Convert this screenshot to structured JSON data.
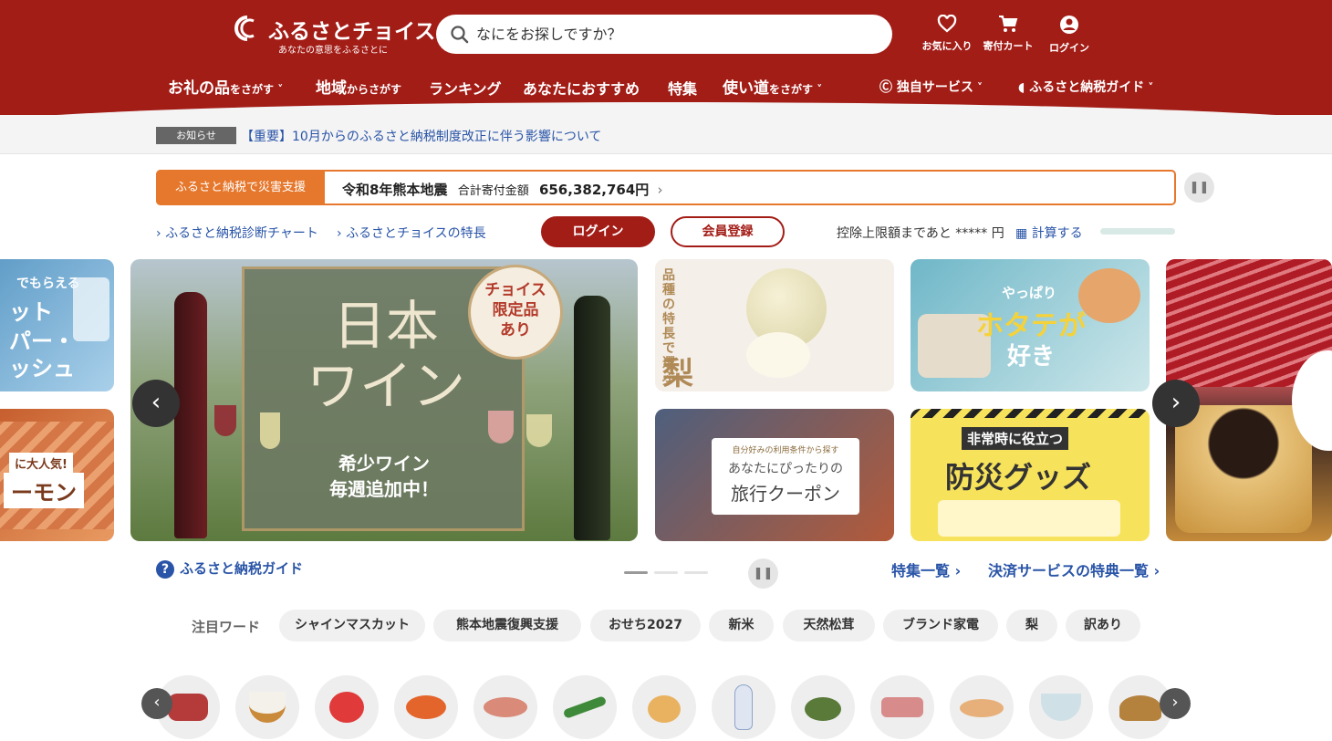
{
  "header": {
    "logo_title": "ふるさとチョイス",
    "logo_sub": "あなたの意思をふるさとに",
    "search_placeholder": "なにをお探しですか？",
    "favorites": "お気に入り",
    "cart": "寄付カート",
    "login": "ログイン"
  },
  "nav": [
    {
      "main": "お礼の品",
      "sub": "をさがす"
    },
    {
      "main": "地域",
      "sub": "からさがす"
    },
    {
      "main": "ランキング",
      "sub": ""
    },
    {
      "main": "あなたにおすすめ",
      "sub": ""
    },
    {
      "main": "特集",
      "sub": ""
    },
    {
      "main": "使い道",
      "sub": "をさがす"
    },
    {
      "main": "独自サービス",
      "sub": ""
    },
    {
      "main": "ふるさと納税ガイド",
      "sub": ""
    }
  ],
  "notice": {
    "tag": "お知らせ",
    "text": "【重要】10月からのふるさと納税制度改正に伴う影響について"
  },
  "disaster": {
    "tag": "ふるさと納税で災害支援",
    "title": "令和8年熊本地震",
    "label": "合計寄付金額",
    "amount": "656,382,764円"
  },
  "quick": {
    "chart": "ふるさと納税診断チャート",
    "features": "ふるさとチョイスの特長",
    "login": "ログイン",
    "register": "会員登録",
    "limit": "控除上限額まであと ***** 円",
    "calc": "計算する"
  },
  "banners": {
    "left_top": [
      "でもらえる",
      "ット",
      "パー・",
      "ッシュ"
    ],
    "left_bottom": [
      "に大人気!",
      "ーモン"
    ],
    "wine_title": "日本\nワイン",
    "wine_badge": "チョイス\n限定品\nあり",
    "wine_sub": "希少ワイン\n毎週追加中！",
    "pear_text": "品種の特長で選ぶ",
    "pear_big": "梨",
    "scallop_top": "やっぱり",
    "scallop_main": "ホタテが",
    "scallop_end": "好き",
    "travel_small": "自分好みの利用条件から探す",
    "travel_mid": "あなたにぴったりの",
    "travel_big": "旅行クーポン",
    "disaster_goods_tag": "非常時に役立つ",
    "disaster_goods": "防災グッズ"
  },
  "below": {
    "guide": "ふるさと納税ガイド",
    "features_list": "特集一覧",
    "payment_list": "決済サービスの特典一覧"
  },
  "words": {
    "title": "注目ワード",
    "items": [
      "シャインマスカット",
      "熊本地震復興支援",
      "おせち2027",
      "新米",
      "天然松茸",
      "ブランド家電",
      "梨",
      "訳あり"
    ]
  },
  "colors": {
    "brand": "#a31d17",
    "accent_orange": "#e6782d",
    "link": "#2954a7"
  }
}
